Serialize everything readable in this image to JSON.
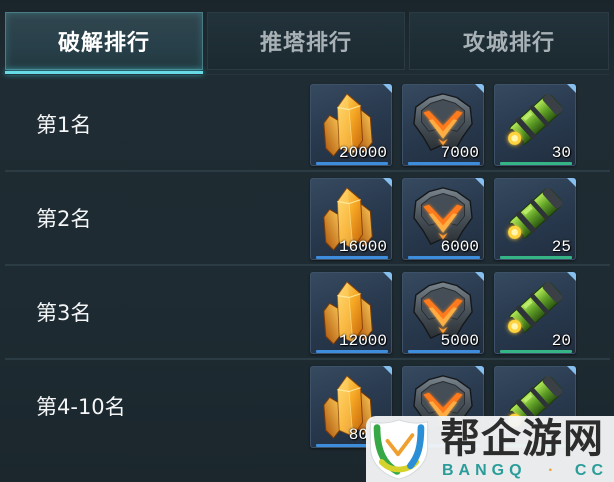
{
  "tabs": [
    {
      "label": "破解排行",
      "active": true
    },
    {
      "label": "推塔排行",
      "active": false
    },
    {
      "label": "攻城排行",
      "active": false
    }
  ],
  "ranks": [
    {
      "label": "第1名",
      "rewards": [
        {
          "icon": "crystal-icon",
          "count": "20000",
          "bar": "blue"
        },
        {
          "icon": "mask-icon",
          "count": "7000",
          "bar": "blue"
        },
        {
          "icon": "cannon-icon",
          "count": "30",
          "bar": "green"
        }
      ]
    },
    {
      "label": "第2名",
      "rewards": [
        {
          "icon": "crystal-icon",
          "count": "16000",
          "bar": "blue"
        },
        {
          "icon": "mask-icon",
          "count": "6000",
          "bar": "blue"
        },
        {
          "icon": "cannon-icon",
          "count": "25",
          "bar": "green"
        }
      ]
    },
    {
      "label": "第3名",
      "rewards": [
        {
          "icon": "crystal-icon",
          "count": "12000",
          "bar": "blue"
        },
        {
          "icon": "mask-icon",
          "count": "5000",
          "bar": "blue"
        },
        {
          "icon": "cannon-icon",
          "count": "20",
          "bar": "green"
        }
      ]
    },
    {
      "label": "第4-10名",
      "rewards": [
        {
          "icon": "crystal-icon",
          "count": "80",
          "bar": "blue"
        },
        {
          "icon": "mask-icon",
          "bar": "blue"
        },
        {
          "icon": "cannon-icon",
          "bar": "green"
        }
      ]
    }
  ],
  "watermark": {
    "title": "帮企游网",
    "domain_left": "BANGQ",
    "domain_dot": "·",
    "domain_right": "CC",
    "logo_icon": "shield-logo-icon"
  },
  "colors": {
    "accent": "#66dbe6",
    "background": "#1e2b32",
    "bar_blue": "#3d8ddc",
    "bar_green": "#35b486",
    "slot_corner": "#86bfee"
  }
}
